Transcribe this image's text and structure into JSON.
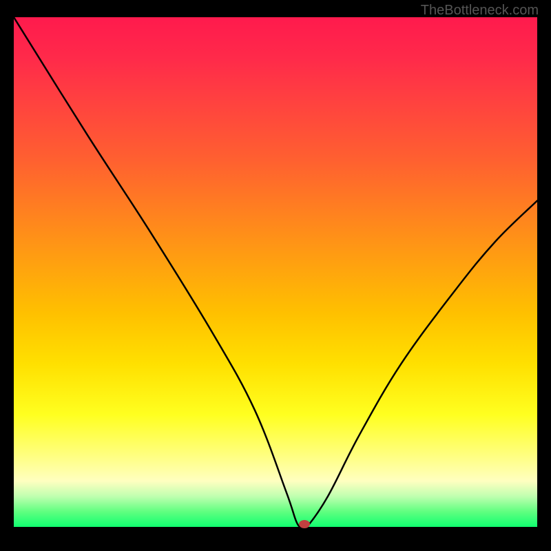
{
  "watermark": "TheBottleneck.com",
  "chart_data": {
    "type": "line",
    "title": "",
    "xlabel": "",
    "ylabel": "",
    "xlim": [
      0,
      100
    ],
    "ylim": [
      0,
      100
    ],
    "grid": false,
    "legend": null,
    "series": [
      {
        "name": "curve",
        "x": [
          0,
          14,
          26,
          38,
          46,
          52,
          54,
          55,
          56,
          60,
          66,
          74,
          84,
          92,
          100
        ],
        "values": [
          100,
          77,
          58,
          38,
          23,
          7,
          1,
          0,
          0,
          6,
          18,
          32,
          46,
          56,
          64
        ]
      }
    ],
    "marker": {
      "x": 55.5,
      "y": 0.5
    },
    "colors": {
      "top": "#ff1a4d",
      "mid": "#ffe000",
      "bottom": "#10ff70",
      "line": "#000000",
      "marker": "#c24040"
    }
  }
}
